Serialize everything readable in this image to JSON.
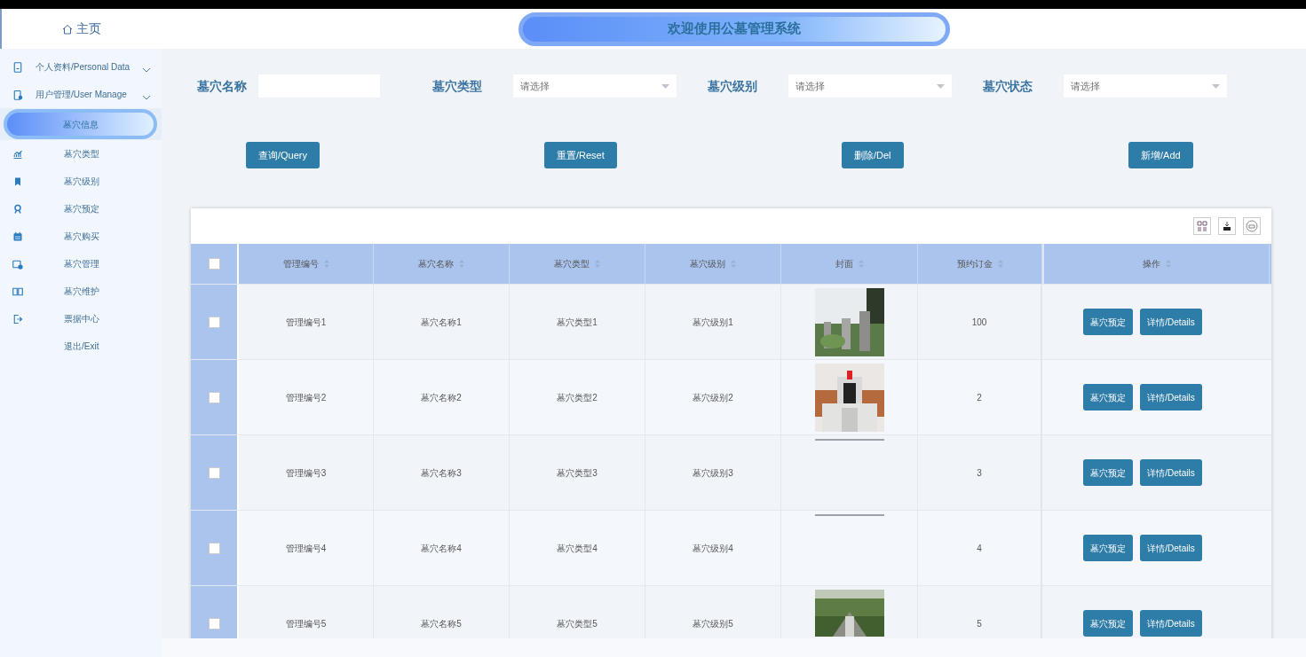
{
  "header": {
    "title": "欢迎使用公墓管理系统"
  },
  "sidebar": {
    "home": "主页",
    "items": [
      {
        "label": "个人资料/Personal Data",
        "expanded": false,
        "selected": false
      },
      {
        "label": "用户管理/User Manage",
        "expanded": false,
        "selected": false
      },
      {
        "label": "墓穴信息",
        "selected": true
      },
      {
        "label": "墓穴类型",
        "selected": false
      },
      {
        "label": "墓穴级别",
        "selected": false
      },
      {
        "label": "墓穴预定",
        "selected": false
      },
      {
        "label": "墓穴购买",
        "selected": false
      },
      {
        "label": "墓穴管理",
        "selected": false
      },
      {
        "label": "墓穴维护",
        "selected": false
      },
      {
        "label": "票据中心",
        "selected": false
      },
      {
        "label": "退出/Exit",
        "selected": false
      }
    ]
  },
  "filters": [
    {
      "kind": "text",
      "label": "墓穴名称"
    },
    {
      "kind": "select",
      "label": "墓穴类型",
      "placeholder": "请选择"
    },
    {
      "kind": "select",
      "label": "墓穴级别",
      "placeholder": "请选择"
    },
    {
      "kind": "select",
      "label": "墓穴状态",
      "placeholder": "请选择"
    }
  ],
  "actions": [
    "查询/Query",
    "重置/Reset",
    "删除/Del",
    "新增/Add"
  ],
  "table": {
    "all_checked": false,
    "columns": [
      "管理编号",
      "墓穴名称",
      "墓穴类型",
      "墓穴级别",
      "封面",
      "预约订金",
      "操作"
    ],
    "rows": [
      {
        "checked": false,
        "cells": [
          "管理编号1",
          "墓穴名称1",
          "墓穴类型1",
          "墓穴级别1"
        ],
        "kind": "picture",
        "deposit": "100",
        "buttons": [
          "墓穴预定",
          "详情/Details"
        ]
      },
      {
        "checked": false,
        "cells": [
          "管理编号2",
          "墓穴名称2",
          "墓穴类型2",
          "墓穴级别2"
        ],
        "kind": "picture",
        "deposit": "2",
        "buttons": [
          "墓穴预定",
          "详情/Details"
        ]
      },
      {
        "checked": false,
        "cells": [
          "管理编号3",
          "墓穴名称3",
          "墓穴类型3",
          "墓穴级别3"
        ],
        "kind": "line",
        "deposit": "3",
        "buttons": [
          "墓穴预定",
          "详情/Details"
        ]
      },
      {
        "checked": false,
        "cells": [
          "管理编号4",
          "墓穴名称4",
          "墓穴类型4",
          "墓穴级别4"
        ],
        "kind": "line",
        "deposit": "4",
        "buttons": [
          "墓穴预定",
          "详情/Details"
        ]
      },
      {
        "checked": false,
        "cells": [
          "管理编号5",
          "墓穴名称5",
          "墓穴类型5",
          "墓穴级别5"
        ],
        "kind": "picture",
        "deposit": "5",
        "buttons": [
          "墓穴预定",
          "详情/Details"
        ]
      }
    ]
  }
}
